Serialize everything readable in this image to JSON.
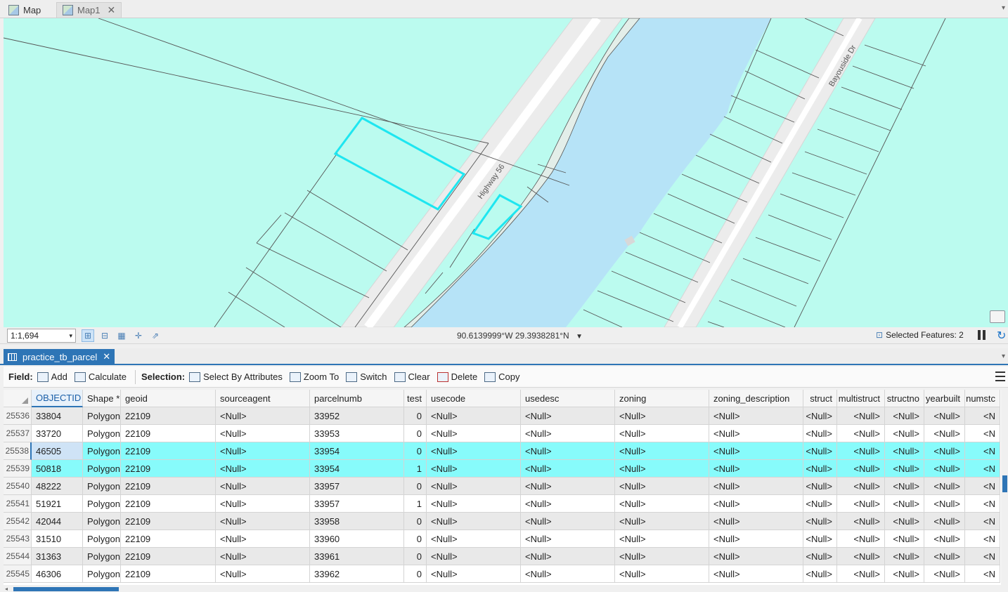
{
  "top_tabs": [
    {
      "label": "Map",
      "closable": false
    },
    {
      "label": "Map1",
      "closable": true,
      "close_glyph": "✕"
    }
  ],
  "map": {
    "road_labels": {
      "highway": "Highway 56",
      "bayouside": "Bayouside Dr"
    }
  },
  "status": {
    "scale": "1:1,694",
    "coordinates": "90.6139999°W 29.3938281°N",
    "selected_features": "Selected Features: 2"
  },
  "table_tab": {
    "label": "practice_tb_parcel",
    "close_glyph": "✕"
  },
  "toolbar": {
    "field_label": "Field:",
    "add": "Add",
    "calculate": "Calculate",
    "selection_label": "Selection:",
    "select_by_attributes": "Select By Attributes",
    "zoom_to": "Zoom To",
    "switch": "Switch",
    "clear": "Clear",
    "delete": "Delete",
    "copy": "Copy"
  },
  "grid": {
    "columns": [
      "OBJECTID *",
      "Shape *",
      "geoid",
      "sourceagent",
      "parcelnumb",
      "test",
      "usecode",
      "usedesc",
      "zoning",
      "zoning_description",
      "struct",
      "multistruct",
      "structno",
      "yearbuilt",
      "numstc"
    ],
    "rows": [
      {
        "n": "25536",
        "v": [
          "33804",
          "Polygon",
          "22109",
          "<Null>",
          "33952",
          "0",
          "<Null>",
          "<Null>",
          "<Null>",
          "<Null>",
          "<Null>",
          "<Null>",
          "<Null>",
          "<Null>",
          "<N"
        ]
      },
      {
        "n": "25537",
        "v": [
          "33720",
          "Polygon",
          "22109",
          "<Null>",
          "33953",
          "0",
          "<Null>",
          "<Null>",
          "<Null>",
          "<Null>",
          "<Null>",
          "<Null>",
          "<Null>",
          "<Null>",
          "<N"
        ]
      },
      {
        "n": "25538",
        "v": [
          "46505",
          "Polygon",
          "22109",
          "<Null>",
          "33954",
          "0",
          "<Null>",
          "<Null>",
          "<Null>",
          "<Null>",
          "<Null>",
          "<Null>",
          "<Null>",
          "<Null>",
          "<N"
        ]
      },
      {
        "n": "25539",
        "v": [
          "50818",
          "Polygon",
          "22109",
          "<Null>",
          "33954",
          "1",
          "<Null>",
          "<Null>",
          "<Null>",
          "<Null>",
          "<Null>",
          "<Null>",
          "<Null>",
          "<Null>",
          "<N"
        ]
      },
      {
        "n": "25540",
        "v": [
          "48222",
          "Polygon",
          "22109",
          "<Null>",
          "33957",
          "0",
          "<Null>",
          "<Null>",
          "<Null>",
          "<Null>",
          "<Null>",
          "<Null>",
          "<Null>",
          "<Null>",
          "<N"
        ]
      },
      {
        "n": "25541",
        "v": [
          "51921",
          "Polygon",
          "22109",
          "<Null>",
          "33957",
          "1",
          "<Null>",
          "<Null>",
          "<Null>",
          "<Null>",
          "<Null>",
          "<Null>",
          "<Null>",
          "<Null>",
          "<N"
        ]
      },
      {
        "n": "25542",
        "v": [
          "42044",
          "Polygon",
          "22109",
          "<Null>",
          "33958",
          "0",
          "<Null>",
          "<Null>",
          "<Null>",
          "<Null>",
          "<Null>",
          "<Null>",
          "<Null>",
          "<Null>",
          "<N"
        ]
      },
      {
        "n": "25543",
        "v": [
          "31510",
          "Polygon",
          "22109",
          "<Null>",
          "33960",
          "0",
          "<Null>",
          "<Null>",
          "<Null>",
          "<Null>",
          "<Null>",
          "<Null>",
          "<Null>",
          "<Null>",
          "<N"
        ]
      },
      {
        "n": "25544",
        "v": [
          "31363",
          "Polygon",
          "22109",
          "<Null>",
          "33961",
          "0",
          "<Null>",
          "<Null>",
          "<Null>",
          "<Null>",
          "<Null>",
          "<Null>",
          "<Null>",
          "<Null>",
          "<N"
        ]
      },
      {
        "n": "25545",
        "v": [
          "46306",
          "Polygon",
          "22109",
          "<Null>",
          "33962",
          "0",
          "<Null>",
          "<Null>",
          "<Null>",
          "<Null>",
          "<Null>",
          "<Null>",
          "<Null>",
          "<Null>",
          "<N"
        ]
      }
    ],
    "selected_rows": [
      2,
      3
    ],
    "current_row": 2
  },
  "colors": {
    "parcel_fill": "#bbfbef",
    "water": "#b6e3f7",
    "selection_outline": "#1ee6f0",
    "selected_row": "#87fbfb",
    "accent": "#2e75b6"
  }
}
